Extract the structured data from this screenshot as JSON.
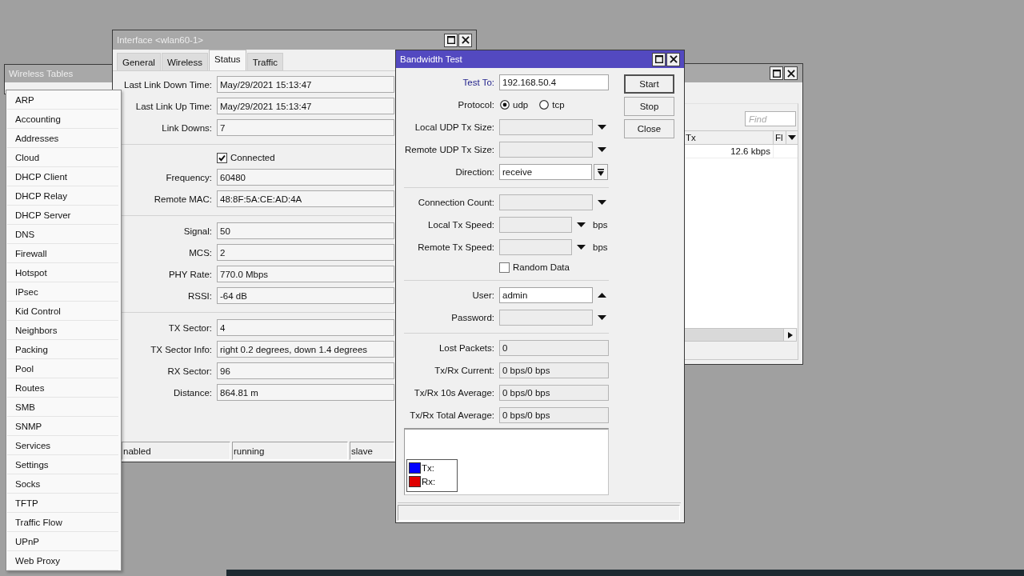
{
  "wireless_tables_window": {
    "title": "Wireless Tables"
  },
  "interface_window": {
    "title": "Interface <wlan60-1>",
    "tabs": [
      {
        "label": "General",
        "selected": false
      },
      {
        "label": "Wireless",
        "selected": false
      },
      {
        "label": "Status",
        "selected": true
      },
      {
        "label": "Traffic",
        "selected": false
      }
    ],
    "sections": [
      [
        {
          "kind": "output",
          "label": "Last Link Down Time:",
          "value": "May/29/2021 15:13:47"
        },
        {
          "kind": "output",
          "label": "Last Link Up Time:",
          "value": "May/29/2021 15:13:47"
        },
        {
          "kind": "output",
          "label": "Link Downs:",
          "value": "7"
        }
      ],
      [
        {
          "kind": "checkbox",
          "label": "Connected",
          "checked": true
        },
        {
          "kind": "output",
          "label": "Frequency:",
          "value": "60480"
        },
        {
          "kind": "output",
          "label": "Remote MAC:",
          "value": "48:8F:5A:CE:AD:4A"
        }
      ],
      [
        {
          "kind": "output",
          "label": "Signal:",
          "value": "50"
        },
        {
          "kind": "output",
          "label": "MCS:",
          "value": "2"
        },
        {
          "kind": "output",
          "label": "PHY Rate:",
          "value": "770.0 Mbps"
        },
        {
          "kind": "output",
          "label": "RSSI:",
          "value": "-64 dB"
        }
      ],
      [
        {
          "kind": "output",
          "label": "TX Sector:",
          "value": "4"
        },
        {
          "kind": "output",
          "label": "TX Sector Info:",
          "value": "right 0.2 degrees, down 1.4 degrees"
        },
        {
          "kind": "output",
          "label": "RX Sector:",
          "value": "96"
        },
        {
          "kind": "output",
          "label": "Distance:",
          "value": "864.81 m"
        }
      ]
    ],
    "status_bar": [
      "nabled",
      "running",
      "slave"
    ]
  },
  "menu": {
    "items": [
      {
        "label": "ARP",
        "selected": false
      },
      {
        "label": "Accounting",
        "selected": false
      },
      {
        "label": "Addresses",
        "selected": false
      },
      {
        "label": "Cloud",
        "selected": false
      },
      {
        "label": "DHCP Client",
        "selected": false
      },
      {
        "label": "DHCP Relay",
        "selected": false
      },
      {
        "label": "DHCP Server",
        "selected": false
      },
      {
        "label": "DNS",
        "selected": false
      },
      {
        "label": "Firewall",
        "selected": false
      },
      {
        "label": "Hotspot",
        "selected": false
      },
      {
        "label": "IPsec",
        "selected": false
      },
      {
        "label": "Kid Control",
        "selected": false
      },
      {
        "label": "Neighbors",
        "selected": false
      },
      {
        "label": "Packing",
        "selected": false
      },
      {
        "label": "Pool",
        "selected": false
      },
      {
        "label": "Routes",
        "selected": false
      },
      {
        "label": "SMB",
        "selected": false
      },
      {
        "label": "SNMP",
        "selected": false
      },
      {
        "label": "Services",
        "selected": false
      },
      {
        "label": "Settings",
        "selected": false
      },
      {
        "label": "Socks",
        "selected": false
      },
      {
        "label": "TFTP",
        "selected": false
      },
      {
        "label": "Traffic Flow",
        "selected": false
      },
      {
        "label": "UPnP",
        "selected": false
      },
      {
        "label": "Web Proxy",
        "selected": false
      }
    ]
  },
  "bandwidth_window": {
    "title": "Bandwidth Test",
    "sections": [
      [
        {
          "kind": "input",
          "label": "Test To:",
          "value": "192.168.50.4",
          "required": true,
          "disabled": false
        },
        {
          "kind": "radio",
          "label": "Protocol:",
          "required": false,
          "options": [
            {
              "label": "udp",
              "selected": true
            },
            {
              "label": "tcp",
              "selected": false
            }
          ]
        },
        {
          "kind": "optional",
          "label": "Local UDP Tx Size:",
          "required": false,
          "disabled": true,
          "expanded": false
        },
        {
          "kind": "optional",
          "label": "Remote UDP Tx Size:",
          "required": false,
          "disabled": true,
          "expanded": false
        },
        {
          "kind": "select",
          "label": "Direction:",
          "value": "receive",
          "required": false,
          "disabled": false
        }
      ],
      [
        {
          "kind": "optional",
          "label": "Connection Count:",
          "required": false,
          "disabled": true,
          "expanded": false
        },
        {
          "kind": "optional",
          "label": "Local Tx Speed:",
          "required": false,
          "disabled": true,
          "expanded": false,
          "unit": "bps"
        },
        {
          "kind": "optional",
          "label": "Remote Tx Speed:",
          "required": false,
          "disabled": true,
          "expanded": false,
          "unit": "bps"
        },
        {
          "kind": "checkbox",
          "label": "Random Data",
          "required": false,
          "checked": false
        }
      ],
      [
        {
          "kind": "optional",
          "label": "User:",
          "value": "admin",
          "required": false,
          "disabled": false,
          "expanded": true
        },
        {
          "kind": "optional",
          "label": "Password:",
          "required": false,
          "disabled": true,
          "expanded": false
        }
      ],
      [
        {
          "kind": "output",
          "label": "Lost Packets:",
          "value": "0",
          "required": false
        },
        {
          "kind": "output",
          "label": "Tx/Rx Current:",
          "value": "0 bps/0 bps",
          "required": false
        },
        {
          "kind": "output",
          "label": "Tx/Rx 10s Average:",
          "value": "0 bps/0 bps",
          "required": false
        },
        {
          "kind": "output",
          "label": "Tx/Rx Total Average:",
          "value": "0 bps/0 bps",
          "required": false
        }
      ]
    ],
    "graph": {
      "legend": [
        {
          "label": "Tx:",
          "color": "#0000ff"
        },
        {
          "label": "Rx:",
          "color": "#e00000"
        }
      ]
    },
    "buttons": [
      {
        "label": "Start",
        "default": true
      },
      {
        "label": "Stop",
        "default": false
      },
      {
        "label": "Close",
        "default": false
      }
    ]
  },
  "list_window": {
    "search": {
      "placeholder": "Find"
    },
    "columns": [
      "Tx",
      "Fl"
    ],
    "rows": [
      [
        "12.6 kbps"
      ]
    ]
  }
}
